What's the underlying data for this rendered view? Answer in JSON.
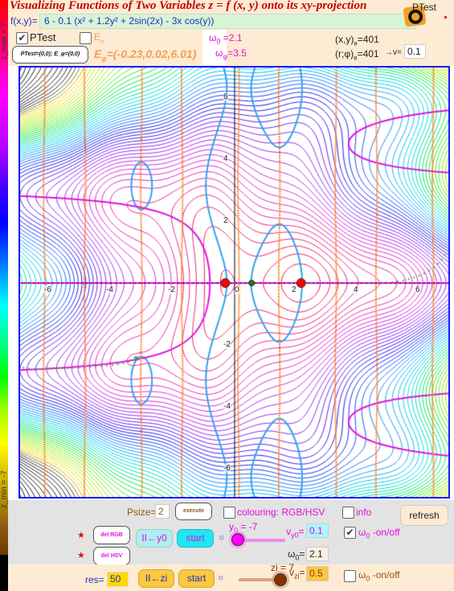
{
  "app": {
    "title": "Visualizing Functions of Two Variables z = f (x, y) onto its xy-projection"
  },
  "function": {
    "label": "f(x,y)=",
    "expression": "6 - 0.1  (x² + 1.2y² + 2sin(2x) - 3x cos(y))"
  },
  "colorbar": {
    "z_max_label": "z_max = 7",
    "z_min_label": "z_min = -7",
    "z_max": 7,
    "z_min": -7
  },
  "top_controls": {
    "ptest_checkbox": {
      "label": "PTest",
      "checked": true
    },
    "ein_checkbox": {
      "label": "E",
      "sub": "in",
      "checked": false
    },
    "ptest_button": "PTest=(0,0); E_φ=(0,0)",
    "e_phi_label": "E",
    "e_phi_sub": "φ",
    "e_phi_value": "=(-0.23,0.02,6.01)",
    "omega0_label": "ω",
    "omega0_sub": "0",
    "omega0_value": " =2.1",
    "omegaphi_label": "ω",
    "omegaphi_sub": "φ",
    "omegaphi_value": "=3.5",
    "xy_e_label": "(x,y)",
    "xy_e_sub": "e",
    "xy_e_value": "=401",
    "rphi_e_label": "(r;φ)",
    "rphi_e_sub": "e",
    "rphi_e_value": "=401",
    "v_label": "→v=",
    "v_value": "0.1",
    "ptest_icon_label": "PTest"
  },
  "plot": {
    "x_range": [
      -7,
      7
    ],
    "y_range": [
      -7,
      7
    ],
    "x_ticks": [
      "-6",
      "-4",
      "-2",
      "0",
      "2",
      "4",
      "6"
    ],
    "y_ticks": [
      "6",
      "4",
      "2",
      "-2",
      "-4",
      "-6"
    ],
    "contour_step": 0.2,
    "critical_points": [
      {
        "x": -0.3,
        "y": 0,
        "color": "#ff0000",
        "kind": "red"
      },
      {
        "x": 2.15,
        "y": 0,
        "color": "#ff0000",
        "kind": "red"
      },
      {
        "x": 0.55,
        "y": 0,
        "color": "#118811",
        "kind": "green"
      }
    ],
    "colors": {
      "frame": "#1a1aff",
      "fx_zero": "#ff8020",
      "fy_zero": "#30a0f0",
      "gradient_path": "#30c030",
      "x_axis_curve": "#e010e0"
    }
  },
  "controls": {
    "psize_label": "Psize=",
    "psize_value": "2",
    "execute_button": "execute",
    "colouring_checkbox": {
      "label": "colouring: RGB/HSV",
      "checked": false
    },
    "info_checkbox": {
      "label": "info",
      "checked": false
    },
    "refresh_button": "refresh",
    "del_rgb_button": "del RGB",
    "del_hsv_button": "del HSV",
    "reset_y0_button": "II←y0",
    "start_y0_button": "start",
    "y0_slider_label": "y",
    "y0_slider_sub": "0",
    "y0_slider_value_text": " = -7",
    "y0_slider_value": -7,
    "y0_slider_range": [
      -7,
      7
    ],
    "vy0_label": "v",
    "vy0_sub": "y0",
    "vy0_value": "0.1",
    "omega0_on_checkbox": {
      "label": "ω",
      "sub": "0",
      "suffix": " -on/off",
      "checked": true
    },
    "omega0_input_label": "ω",
    "omega0_input_sub": "0",
    "omega0_input_value": "2.1",
    "res_label": "res=",
    "res_value": "50",
    "reset_zi_button": "II←zi",
    "start_zi_button": "start",
    "zi_slider_label": "zi = 7",
    "zi_slider_value": 7,
    "zi_slider_range": [
      -7,
      7
    ],
    "vzi_label": "v",
    "vzi_sub": "zi",
    "vzi_value": "0.5",
    "omega0_off_checkbox": {
      "label": "ω",
      "sub": "0",
      "suffix": " -on/off",
      "checked": false
    }
  }
}
